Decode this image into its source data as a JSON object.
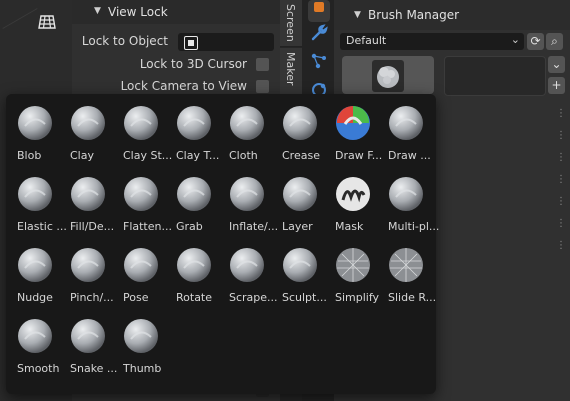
{
  "view_lock": {
    "title": "View Lock",
    "lock_to_object_label": "Lock to Object",
    "lock_to_3d_cursor_label": "Lock to 3D Cursor",
    "lock_camera_to_view_label": "Lock Camera to View"
  },
  "side_tabs": [
    "Screen",
    "Maker"
  ],
  "brush_manager": {
    "title": "Brush Manager",
    "dropdown_value": "Default"
  },
  "brush_popup": {
    "brushes": [
      {
        "label": "Blob",
        "icon": "blob-brush-icon"
      },
      {
        "label": "Clay",
        "icon": "clay-brush-icon"
      },
      {
        "label": "Clay St...",
        "icon": "clay-strips-brush-icon"
      },
      {
        "label": "Clay T...",
        "icon": "clay-thumb-brush-icon"
      },
      {
        "label": "Cloth",
        "icon": "cloth-brush-icon"
      },
      {
        "label": "Crease",
        "icon": "crease-brush-icon"
      },
      {
        "label": "Draw F...",
        "icon": "draw-face-sets-brush-icon"
      },
      {
        "label": "Draw ...",
        "icon": "draw-sharp-brush-icon"
      },
      {
        "label": "Elastic ...",
        "icon": "elastic-deform-brush-icon"
      },
      {
        "label": "Fill/De...",
        "icon": "fill-deepen-brush-icon"
      },
      {
        "label": "Flatten...",
        "icon": "flatten-contrast-brush-icon"
      },
      {
        "label": "Grab",
        "icon": "grab-brush-icon"
      },
      {
        "label": "Inflate/...",
        "icon": "inflate-deflate-brush-icon"
      },
      {
        "label": "Layer",
        "icon": "layer-brush-icon"
      },
      {
        "label": "Mask",
        "icon": "mask-brush-icon"
      },
      {
        "label": "Multi-pl...",
        "icon": "multiplane-scrape-brush-icon"
      },
      {
        "label": "Nudge",
        "icon": "nudge-brush-icon"
      },
      {
        "label": "Pinch/...",
        "icon": "pinch-magnify-brush-icon"
      },
      {
        "label": "Pose",
        "icon": "pose-brush-icon"
      },
      {
        "label": "Rotate",
        "icon": "rotate-brush-icon"
      },
      {
        "label": "Scrape...",
        "icon": "scrape-peaks-brush-icon"
      },
      {
        "label": "Sculpt...",
        "icon": "sculpt-draw-brush-icon"
      },
      {
        "label": "Simplify",
        "icon": "simplify-brush-icon"
      },
      {
        "label": "Slide R...",
        "icon": "slide-relax-brush-icon"
      },
      {
        "label": "Smooth",
        "icon": "smooth-brush-icon"
      },
      {
        "label": "Snake ...",
        "icon": "snake-hook-brush-icon"
      },
      {
        "label": "Thumb",
        "icon": "thumb-brush-icon"
      }
    ]
  },
  "colors": {
    "popup_bg": "#181818",
    "panel_bg": "#303030",
    "sphere_base": "#b9bcc0",
    "accent_orange": "#e07a26",
    "accent_blue": "#4a8bd6"
  }
}
